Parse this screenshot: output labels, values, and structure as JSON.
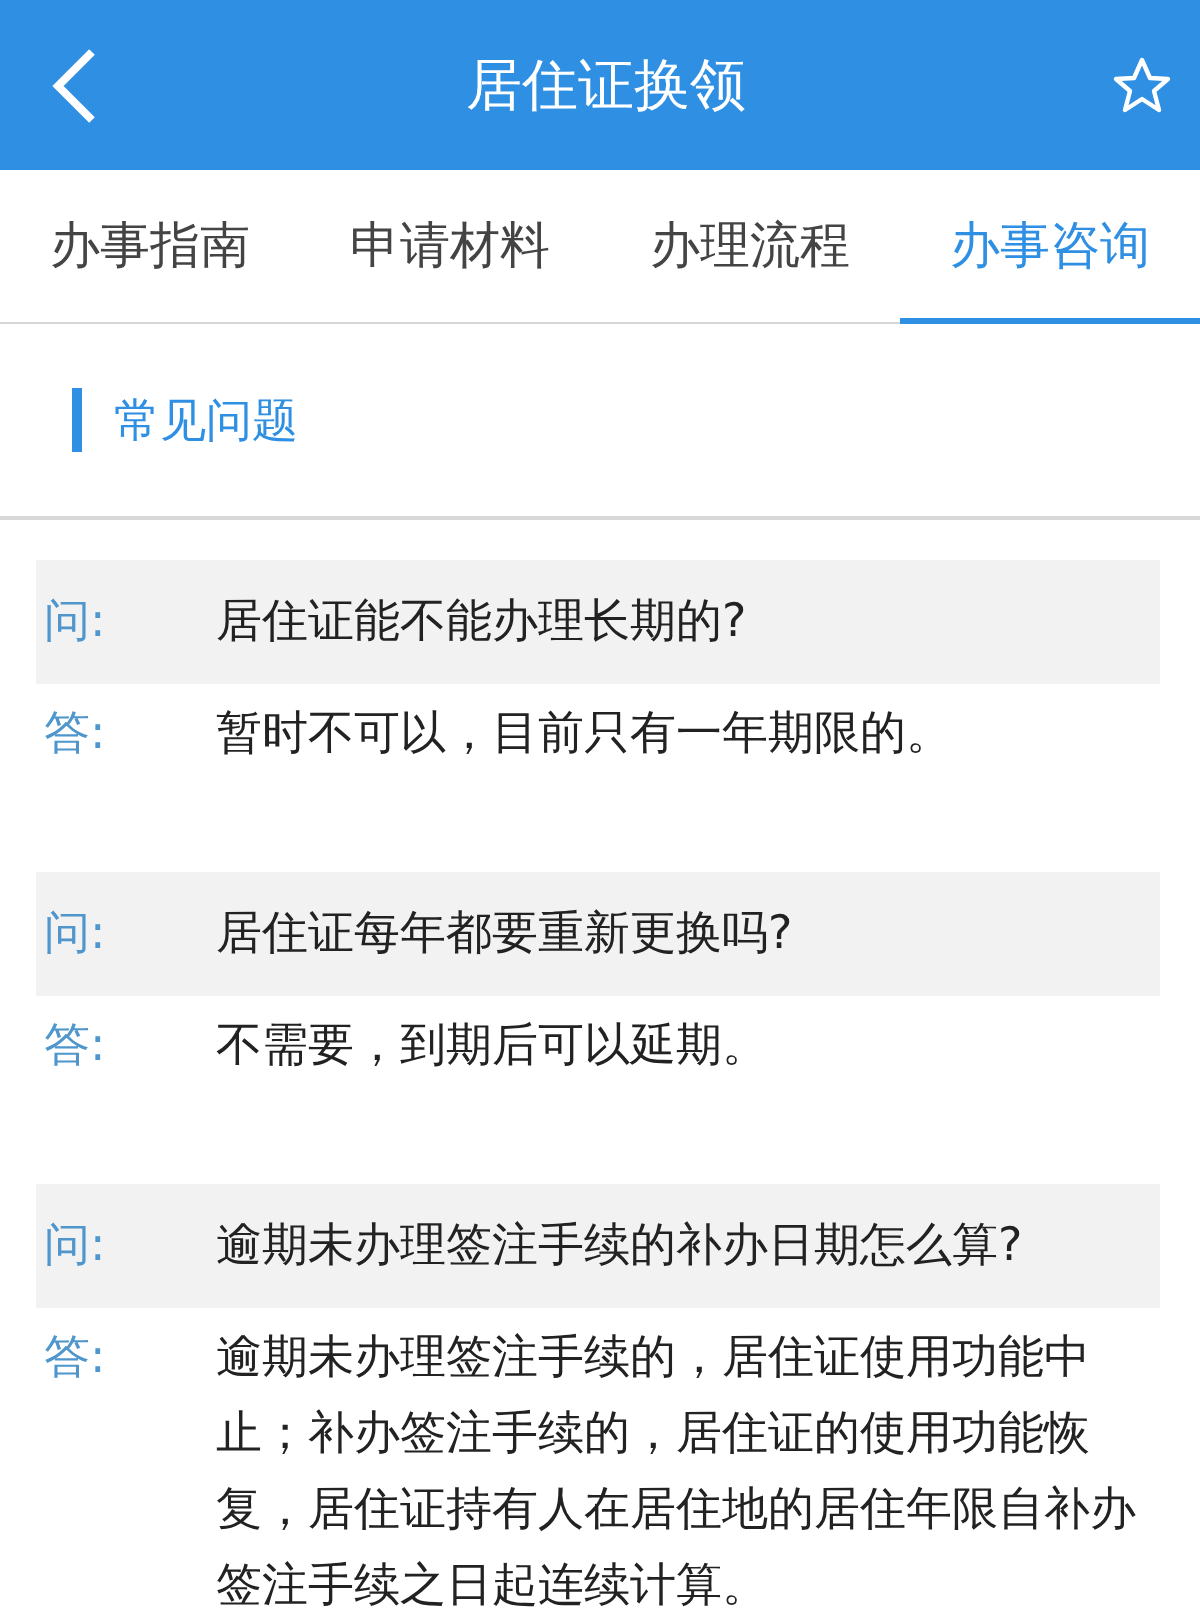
{
  "header": {
    "title": "居住证换领"
  },
  "tabs": [
    {
      "label": "办事指南",
      "selected": false
    },
    {
      "label": "申请材料",
      "selected": false
    },
    {
      "label": "办理流程",
      "selected": false
    },
    {
      "label": "办事咨询",
      "selected": true
    }
  ],
  "section": {
    "title": "常见问题"
  },
  "faq": [
    {
      "q_label": "问:",
      "question": "居住证能不能办理长期的?",
      "a_label": "答:",
      "answer": "暂时不可以，目前只有一年期限的。"
    },
    {
      "q_label": "问:",
      "question": "居住证每年都要重新更换吗?",
      "a_label": "答:",
      "answer": "不需要，到期后可以延期。"
    },
    {
      "q_label": "问:",
      "question": "逾期未办理签注手续的补办日期怎么算?",
      "a_label": "答:",
      "answer": "逾期未办理签注手续的，居住证使用功能中止；补办签注手续的，居住证的使用功能恢复，居住证持有人在居住地的居住年限自补办签注手续之日起连续计算。"
    }
  ]
}
